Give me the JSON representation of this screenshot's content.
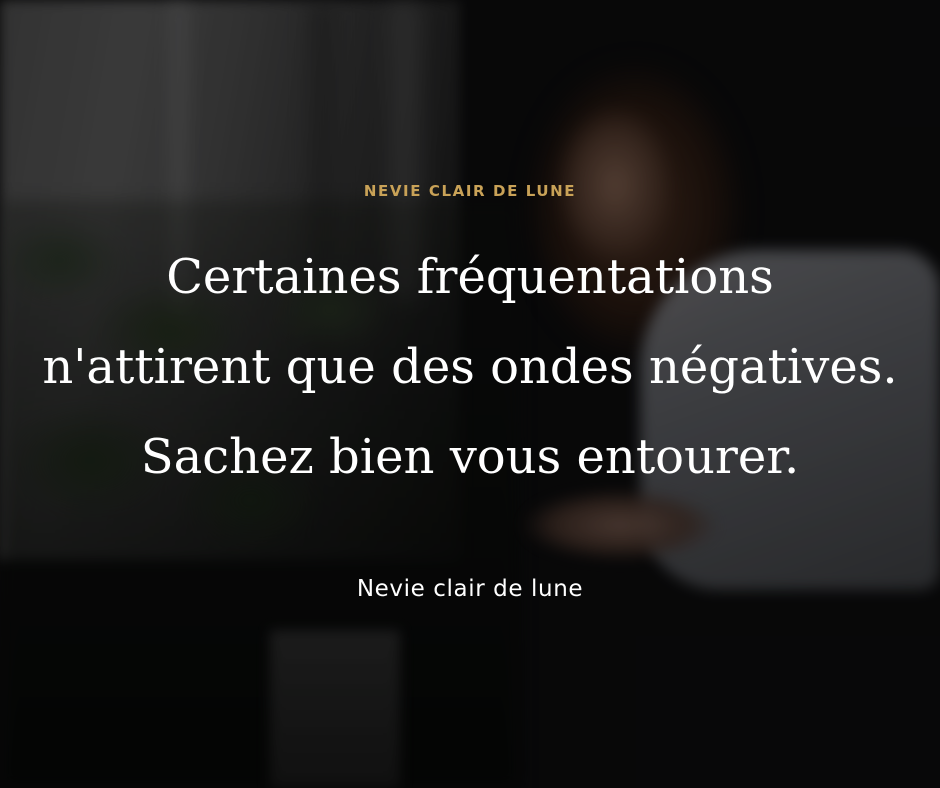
{
  "header": {
    "brand": "NEVIE CLAIR DE LUNE"
  },
  "quote": {
    "lines": [
      "Certaines fréquentations",
      "n'attirent que des ondes négatives.",
      "Sachez bien vous entourer."
    ]
  },
  "footer": {
    "author": "Nevie clair de lune"
  },
  "colors": {
    "brand": "#c9a257",
    "text": "#ffffff"
  }
}
